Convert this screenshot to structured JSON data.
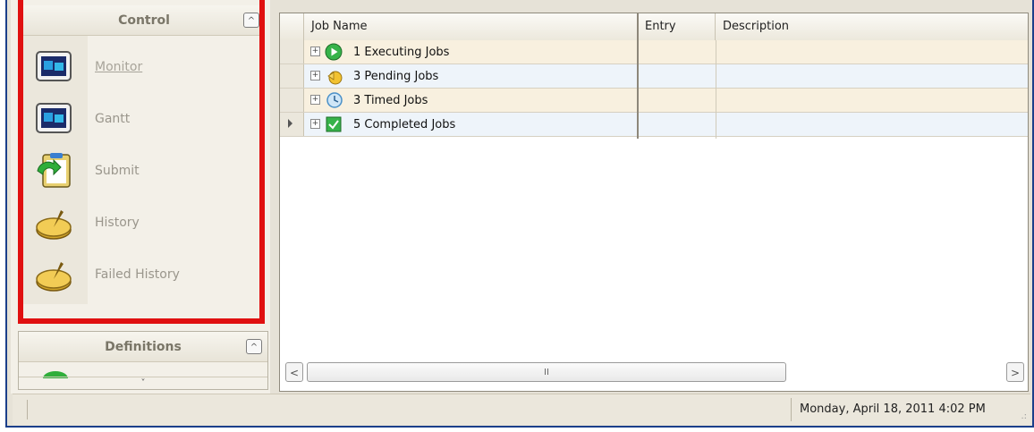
{
  "nav": {
    "control_title": "Control",
    "collapse_symbol": "^",
    "items": [
      {
        "label": "Monitor",
        "icon": "monitor-icon"
      },
      {
        "label": "Gantt",
        "icon": "gantt-icon"
      },
      {
        "label": "Submit",
        "icon": "submit-clipboard-icon"
      },
      {
        "label": "History",
        "icon": "history-icon"
      },
      {
        "label": "Failed History",
        "icon": "failed-history-icon"
      }
    ],
    "definitions_title": "Definitions",
    "more_symbol": "˅"
  },
  "grid": {
    "columns": [
      "Job Name",
      "Entry",
      "Description"
    ],
    "rows": [
      {
        "label": "1 Executing Jobs",
        "icon": "executing-jobs-icon",
        "entry": "",
        "description": ""
      },
      {
        "label": "3 Pending Jobs",
        "icon": "pending-jobs-icon",
        "entry": "",
        "description": ""
      },
      {
        "label": "3 Timed Jobs",
        "icon": "timed-jobs-icon",
        "entry": "",
        "description": ""
      },
      {
        "label": "5 Completed Jobs",
        "icon": "completed-jobs-icon",
        "entry": "",
        "description": ""
      }
    ],
    "expander_symbol": "+",
    "scroll_left": "<",
    "scroll_right": ">",
    "scroll_thumb_grip": "II"
  },
  "status": {
    "datetime": "Monday, April 18, 2011  4:02 PM",
    "grip": ".:"
  },
  "colors": {
    "highlight_border": "#e01010",
    "row_odd": "#f8f0df",
    "row_even": "#eef4fa"
  }
}
